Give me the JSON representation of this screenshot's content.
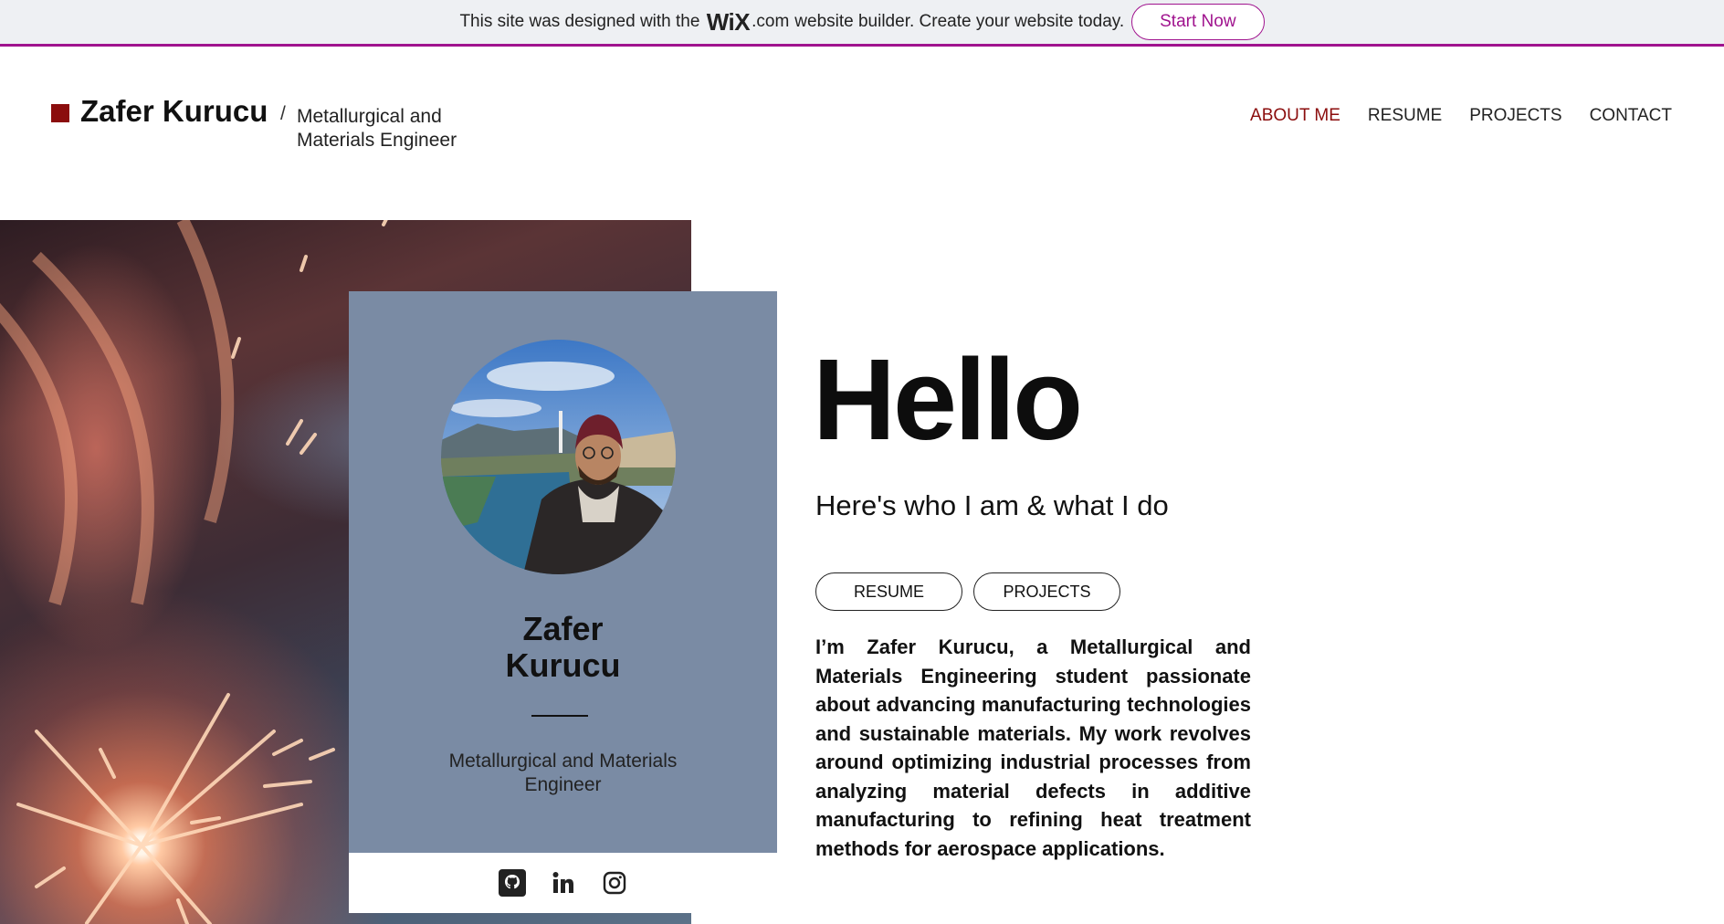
{
  "banner": {
    "text_before": "This site was designed with the",
    "brand": "WiX",
    "brand_suffix": ".com",
    "text_after": "website builder. Create your website today.",
    "cta_label": "Start Now"
  },
  "header": {
    "name": "Zafer Kurucu",
    "separator": "/",
    "subtitle": "Metallurgical and Materials Engineer",
    "nav": [
      {
        "label": "ABOUT ME",
        "active": true
      },
      {
        "label": "RESUME",
        "active": false
      },
      {
        "label": "PROJECTS",
        "active": false
      },
      {
        "label": "CONTACT",
        "active": false
      }
    ]
  },
  "card": {
    "name_line1": "Zafer",
    "name_line2": "Kurucu",
    "role_line1": "Metallurgical and Materials",
    "role_line2": "Engineer",
    "socials": [
      "github-icon",
      "linkedin-icon",
      "instagram-icon"
    ]
  },
  "main": {
    "heading": "Hello",
    "tagline": "Here's who I am & what I do",
    "buttons": {
      "resume": "RESUME",
      "projects": "PROJECTS"
    },
    "bio": "I’m Zafer Kurucu, a Metallurgical and Materials Engineering student passionate about advancing manufacturing technologies and sustainable materials. My work revolves around optimizing industrial processes from analyzing material defects in additive manufacturing to refining heat treatment methods for aerospace applications."
  },
  "colors": {
    "accent": "#8b0d0d",
    "wix_brand": "#a0138e",
    "card_bg": "#7a8ba4",
    "banner_bg": "#eef0f3"
  }
}
